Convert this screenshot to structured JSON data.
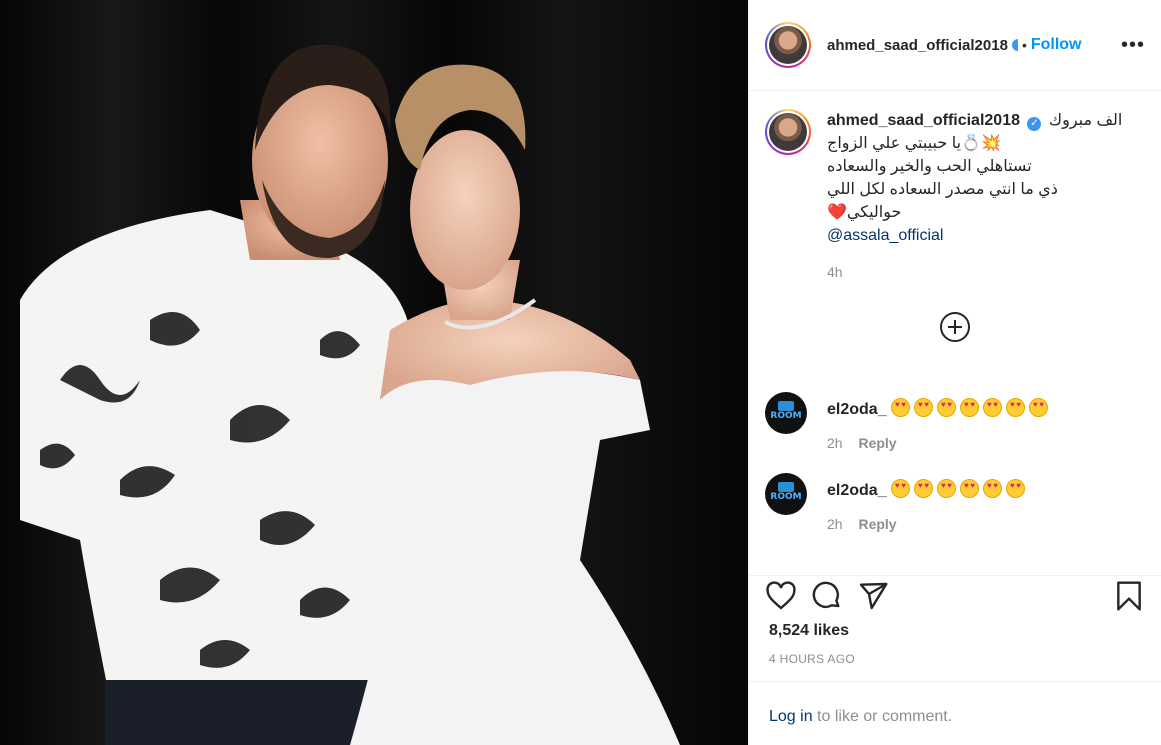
{
  "header": {
    "username": "ahmed_saad_official2018",
    "separator": "•",
    "follow_label": "Follow",
    "more_label": "•••"
  },
  "caption": {
    "username": "ahmed_saad_official2018",
    "verified_glyph": "✓",
    "line1": "الف مبروك",
    "line2": "💥💍يا حبيبتي علي الزواج",
    "line3": "تستاهلي الحب والخير والسعاده",
    "line4": "ذي ما انتي مصدر السعاده لكل اللي",
    "line5": "حواليكي❤️",
    "mention": "@assala_official",
    "time": "4h"
  },
  "comments": [
    {
      "username": "el2oda_",
      "emoji_count": 7,
      "time": "2h",
      "reply_label": "Reply",
      "avatar_text": "ROOM"
    },
    {
      "username": "el2oda_",
      "emoji_count": 6,
      "time": "2h",
      "reply_label": "Reply",
      "avatar_text": "ROOM"
    }
  ],
  "icons": [
    "heart-icon",
    "comment-icon",
    "share-icon",
    "bookmark-icon",
    "load-more-icon"
  ],
  "stats": {
    "likes": "8,524 likes",
    "posted": "4 HOURS AGO"
  },
  "login": {
    "link": "Log in",
    "text": " to like or comment."
  },
  "colors": {
    "accent": "#0095f6",
    "muted": "#8e8e8e",
    "text": "#262626",
    "mention": "#00376b"
  }
}
